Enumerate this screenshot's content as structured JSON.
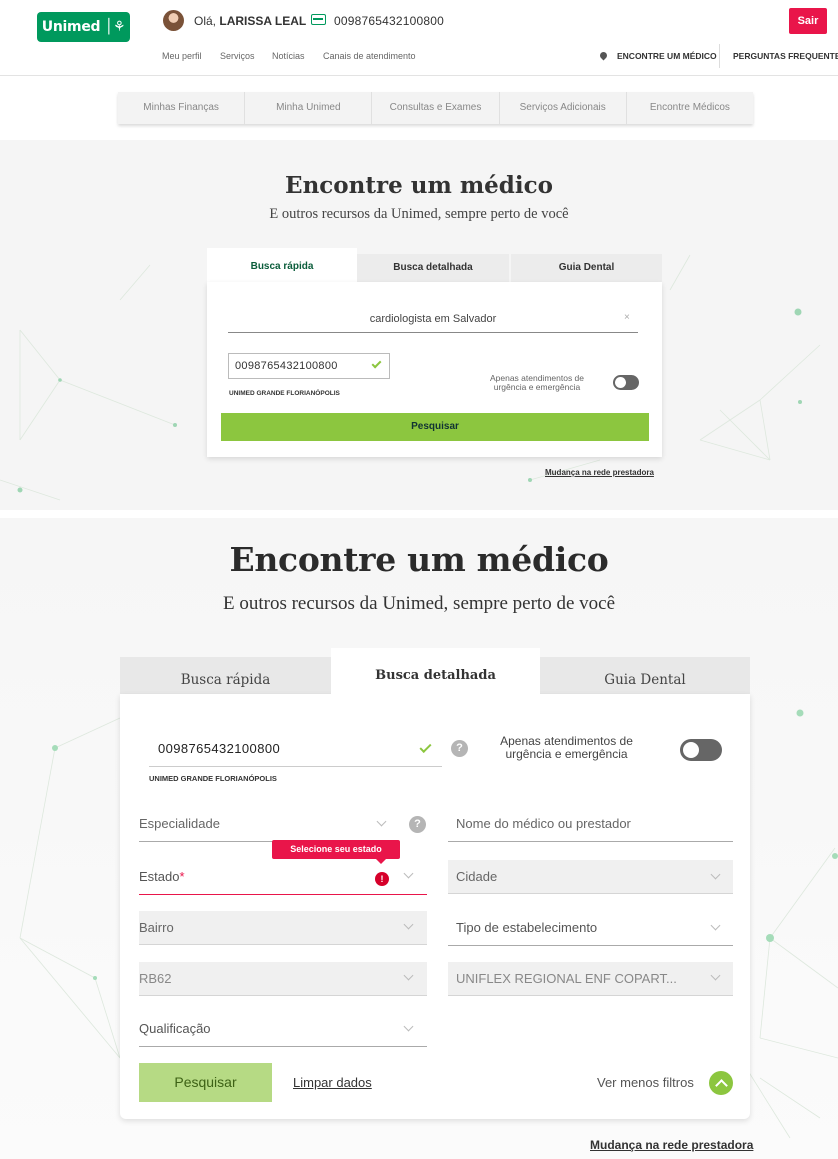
{
  "header": {
    "logo": "Unimed │⚘",
    "greeting_prefix": "Olá,",
    "user_name": "LARISSA LEAL",
    "card_number": "0098765432100800",
    "logout_label": "Sair",
    "links": [
      "Meu perfil",
      "Serviços",
      "Notícias",
      "Canais de atendimento"
    ],
    "find_doctor_label": "ENCONTRE UM MÉDICO",
    "faq_label": "PERGUNTAS FREQUENTES"
  },
  "main_tabs": [
    "Minhas Finanças",
    "Minha Unimed",
    "Consultas e Exames",
    "Serviços Adicionais",
    "Encontre Médicos"
  ],
  "quick_search": {
    "title": "Encontre um médico",
    "subtitle": "E outros recursos da Unimed, sempre perto de você",
    "tabs": [
      "Busca rápida",
      "Busca detalhada",
      "Guia Dental"
    ],
    "query": "cardiologista em Salvador",
    "clear_icon": "×",
    "card_number": "0098765432100800",
    "operator": "UNIMED GRANDE FLORIANÓPOLIS",
    "urgency_label": "Apenas atendimentos de urgência e emergência",
    "search_button": "Pesquisar",
    "network_change_link": "Mudança na rede prestadora"
  },
  "detailed_search": {
    "title": "Encontre um médico",
    "subtitle": "E outros recursos da Unimed, sempre perto de você",
    "tabs": [
      "Busca rápida",
      "Busca detalhada",
      "Guia Dental"
    ],
    "card_number": "0098765432100800",
    "operator": "UNIMED GRANDE FLORIANÓPOLIS",
    "help_icon": "?",
    "urgency_label": "Apenas atendimentos de urgência e emergência",
    "specialty_placeholder": "Especialidade",
    "doctor_name_placeholder": "Nome do médico ou prestador",
    "state_tooltip": "Selecione seu estado",
    "error_icon": "!",
    "state_label": "Estado",
    "required_mark": "*",
    "city_placeholder": "Cidade",
    "neighborhood_placeholder": "Bairro",
    "establishment_type_placeholder": "Tipo de estabelecimento",
    "network_value": "RB62",
    "plan_value": "UNIFLEX REGIONAL ENF COPART...",
    "qualification_placeholder": "Qualificação",
    "search_button": "Pesquisar",
    "clear_data_link": "Limpar dados",
    "fewer_filters_label": "Ver menos filtros",
    "network_change_link": "Mudança na rede prestadora"
  },
  "colors": {
    "unimed_green": "#00995d",
    "lime_green": "#8cc63f",
    "alert_pink": "#e9154a"
  }
}
